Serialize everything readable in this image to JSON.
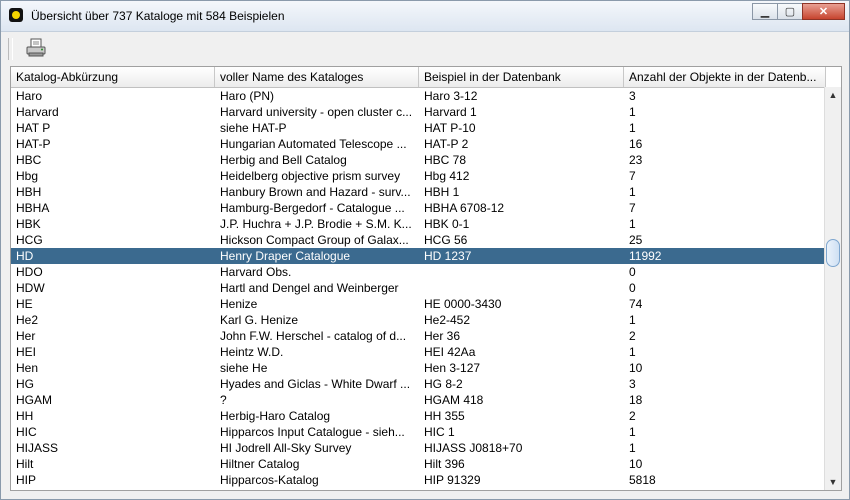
{
  "window": {
    "title": "Übersicht über 737 Kataloge mit 584 Beispielen"
  },
  "columns": [
    "Katalog-Abkürzung",
    "voller Name des Kataloges",
    "Beispiel in der Datenbank",
    "Anzahl der Objekte in der Datenb..."
  ],
  "rows": [
    [
      "Haro",
      "Haro (PN)",
      "Haro 3-12",
      "3"
    ],
    [
      "Harvard",
      "Harvard university - open cluster c...",
      "Harvard 1",
      "1"
    ],
    [
      "HAT P",
      "siehe HAT-P",
      "HAT P-10",
      "1"
    ],
    [
      "HAT-P",
      "Hungarian Automated Telescope ...",
      "HAT-P 2",
      "16"
    ],
    [
      "HBC",
      "Herbig and Bell Catalog",
      "HBC 78",
      "23"
    ],
    [
      "Hbg",
      "Heidelberg objective prism survey",
      "Hbg 412",
      "7"
    ],
    [
      "HBH",
      "Hanbury Brown and Hazard - surv...",
      "HBH 1",
      "1"
    ],
    [
      "HBHA",
      "Hamburg-Bergedorf - Catalogue ...",
      "HBHA 6708-12",
      "7"
    ],
    [
      "HBK",
      "J.P. Huchra + J.P. Brodie + S.M. K...",
      "HBK 0-1",
      "1"
    ],
    [
      "HCG",
      "Hickson Compact Group of Galax...",
      "HCG 56",
      "25"
    ],
    [
      "HD",
      "Henry Draper Catalogue",
      "HD 1237",
      "11992"
    ],
    [
      "HDO",
      "Harvard Obs.",
      "",
      "0"
    ],
    [
      "HDW",
      "Hartl and Dengel and Weinberger",
      "",
      "0"
    ],
    [
      "HE",
      "Henize",
      "HE 0000-3430",
      "74"
    ],
    [
      "He2",
      "Karl G. Henize",
      "He2-452",
      "1"
    ],
    [
      "Her",
      "John F.W. Herschel - catalog of d...",
      "Her 36",
      "2"
    ],
    [
      "HEI",
      "Heintz W.D.",
      "HEI 42Aa",
      "1"
    ],
    [
      "Hen",
      "siehe He",
      "Hen 3-127",
      "10"
    ],
    [
      "HG",
      "Hyades and Giclas - White Dwarf ...",
      "HG 8-2",
      "3"
    ],
    [
      "HGAM",
      "?",
      "HGAM 418",
      "18"
    ],
    [
      "HH",
      "Herbig-Haro Catalog",
      "HH 355",
      "2"
    ],
    [
      "HIC",
      "Hipparcos Input Catalogue - sieh...",
      "HIC 1",
      "1"
    ],
    [
      "HIJASS",
      "HI Jodrell All-Sky Survey",
      "HIJASS J0818+70",
      "1"
    ],
    [
      "Hilt",
      "Hiltner Catalog",
      "Hilt 396",
      "10"
    ],
    [
      "HIP",
      "Hipparcos-Katalog",
      "HIP 91329",
      "5818"
    ]
  ],
  "selected_row": 10,
  "colors": {
    "selection": "#3b6a8f",
    "titlebar": "#dde6f1"
  },
  "icons": {
    "app": "app-icon",
    "toolbar_print": "print-icon"
  }
}
